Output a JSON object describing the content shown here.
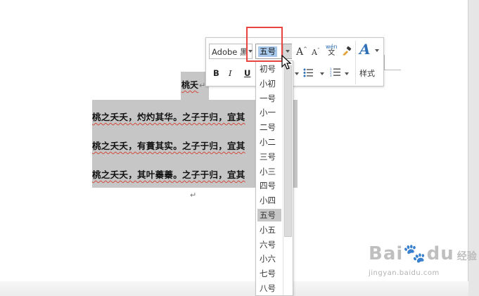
{
  "document": {
    "title": "桃夭",
    "paragraph_mark": "↵",
    "paragraphs": [
      "桃之夭夭，灼灼其华。之子于归，宜其",
      "桃之夭夭，有蕡其实。之子于归，宜其",
      "桃之夭夭，其叶蓁蓁。之子于归，宜其"
    ]
  },
  "mini_toolbar": {
    "font_name": "Adobe 黑",
    "font_size": "五号",
    "styles_label": "样式",
    "bold_label": "B",
    "italic_label": "I",
    "underline_label": "U",
    "grow_label": "A",
    "shrink_label": "A",
    "phonetic_pinyin": "wén",
    "phonetic_char": "文",
    "styles_glyph": "A"
  },
  "font_size_dropdown": {
    "items": [
      "初号",
      "小初",
      "一号",
      "小一",
      "二号",
      "小二",
      "三号",
      "小三",
      "四号",
      "小四",
      "五号",
      "小五",
      "六号",
      "小六",
      "七号",
      "八号"
    ],
    "selected": "五号"
  },
  "watermark": {
    "logo": "Bai",
    "logo_tail": "du",
    "text": "经验",
    "url": "jingyan.baidu.com"
  },
  "colors": {
    "selection_gray": "#c6c6c6",
    "highlight_red": "#e8433e",
    "size_selection_blue": "#a8c8ec",
    "styles_blue": "#2e6fb7"
  }
}
